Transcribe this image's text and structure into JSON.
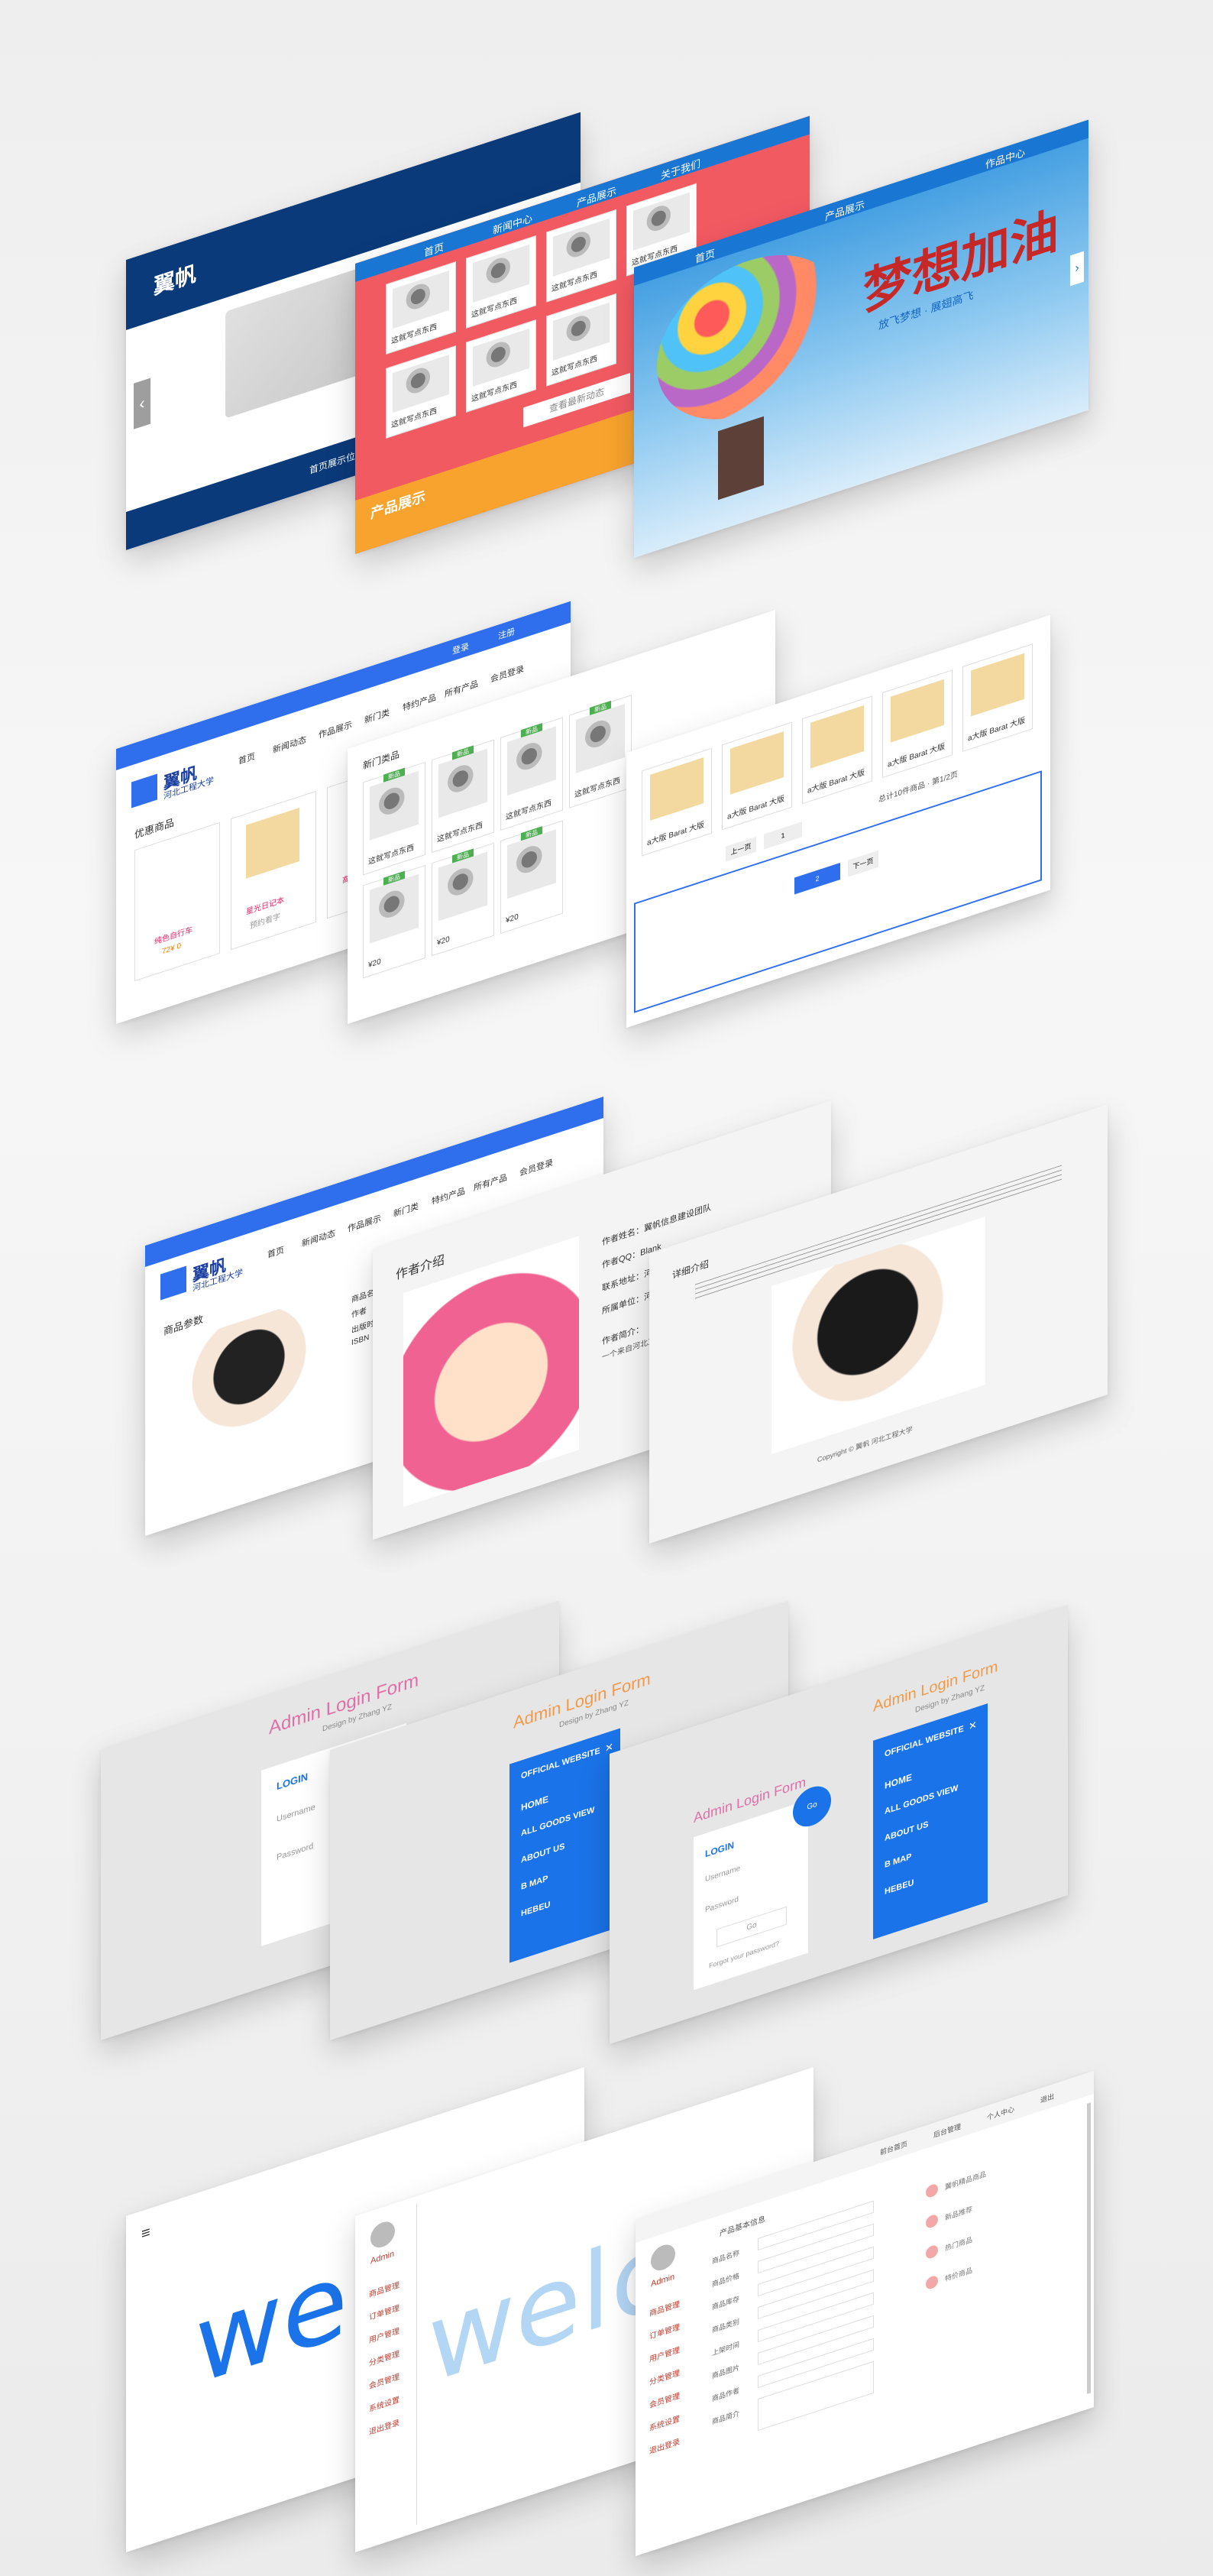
{
  "row1": {
    "card_a": {
      "logo": "翼帆",
      "caption": "首页展示位 · 完美呈现"
    },
    "card_b": {
      "tabs": [
        "首页",
        "新闻中心",
        "产品展示",
        "关于我们"
      ],
      "item_caption": "这就写点东西",
      "more_button": "查看最新动态",
      "section_title": "产品展示"
    },
    "card_c": {
      "tabs": [
        "首页",
        "产品展示",
        "作品中心"
      ],
      "banner_title": "梦想加油",
      "banner_sub": "放飞梦想 · 展翅高飞"
    }
  },
  "row2": {
    "card_a": {
      "top_links": [
        "登录",
        "注册"
      ],
      "logo_main": "翼帆",
      "logo_sub": "河北工程大学",
      "nav": [
        "首页",
        "新闻动态",
        "作品展示",
        "新门类",
        "特约产品",
        "所有产品",
        "会员登录"
      ],
      "section": "优惠商品",
      "price_label": "预约看字",
      "price_value": "72¥ 0",
      "items": [
        "纯色自行车",
        "星光日记本",
        "高品质"
      ]
    },
    "card_b": {
      "section": "新门类品",
      "tag": "新品",
      "caption": "这就写点东西",
      "sub": "¥20"
    },
    "card_c": {
      "captions": [
        "a大版 Barat 大版 Barat小",
        "a大版 Barat 大版 Barat小",
        "a大版 Barat 大版 Barat小",
        "a大版 Barat 大版 Barat小",
        "a大版 Barat 大版 Barat小"
      ],
      "pager_note": "总计10件商品 · 第1/2页",
      "pager": [
        "上一页",
        "1",
        "2",
        "下一页"
      ]
    }
  },
  "row3": {
    "card_a": {
      "logo_main": "翼帆",
      "logo_sub": "河北工程大学",
      "nav": [
        "首页",
        "新闻动态",
        "作品展示",
        "新门类",
        "特约产品",
        "所有产品",
        "会员登录"
      ],
      "section": "商品参数",
      "params": [
        "商品名称",
        "作者",
        "出版时间",
        "ISBN"
      ]
    },
    "card_b": {
      "section": "作者介绍",
      "lines": [
        "作者姓名：翼帆信息建设团队",
        "作者QQ：Blank",
        "联系地址：河北·邯郸",
        "所属单位：河北工程大学",
        "作者简介：",
        "一个来自河北工程大学的设计团队"
      ]
    },
    "card_c": {
      "section": "详细介绍",
      "footer": "Copyright © 翼帆 河北工程大学"
    }
  },
  "row4": {
    "form_title": "Admin Login Form",
    "form_sub": "Design by Zhang YZ",
    "login": {
      "title": "LOGIN",
      "username_placeholder": "Username",
      "password_placeholder": "Password",
      "button": "Go",
      "forgot": "Forgot your password?"
    },
    "menu": {
      "title": "OFFICIAL WEBSITE",
      "close": "✕",
      "items": [
        "HOME",
        "ALL GOODS VIEW",
        "ABOUT US",
        "B MAP",
        "HEBEU"
      ]
    },
    "fab_label": "Go"
  },
  "row5": {
    "welcome": "welco",
    "admin_name": "Admin",
    "sidebar": [
      "商品管理",
      "订单管理",
      "用户管理",
      "分类管理",
      "会员管理",
      "系统设置",
      "退出登录"
    ],
    "top_tabs": [
      "前台首页",
      "后台管理",
      "个人中心",
      "退出"
    ],
    "form_title": "产品基本信息",
    "form_labels": [
      "商品名称",
      "商品价格",
      "商品库存",
      "商品类别",
      "上架时间",
      "商品图片",
      "商品作者",
      "商品简介"
    ],
    "right_list": [
      "翼帆精品商品",
      "新品推荐",
      "热门商品",
      "特价商品"
    ],
    "accent_colors": {
      "blue": "#1a73e8",
      "red": "#c0392b",
      "pink": "#e06fa8",
      "orange": "#f29a4a"
    }
  }
}
